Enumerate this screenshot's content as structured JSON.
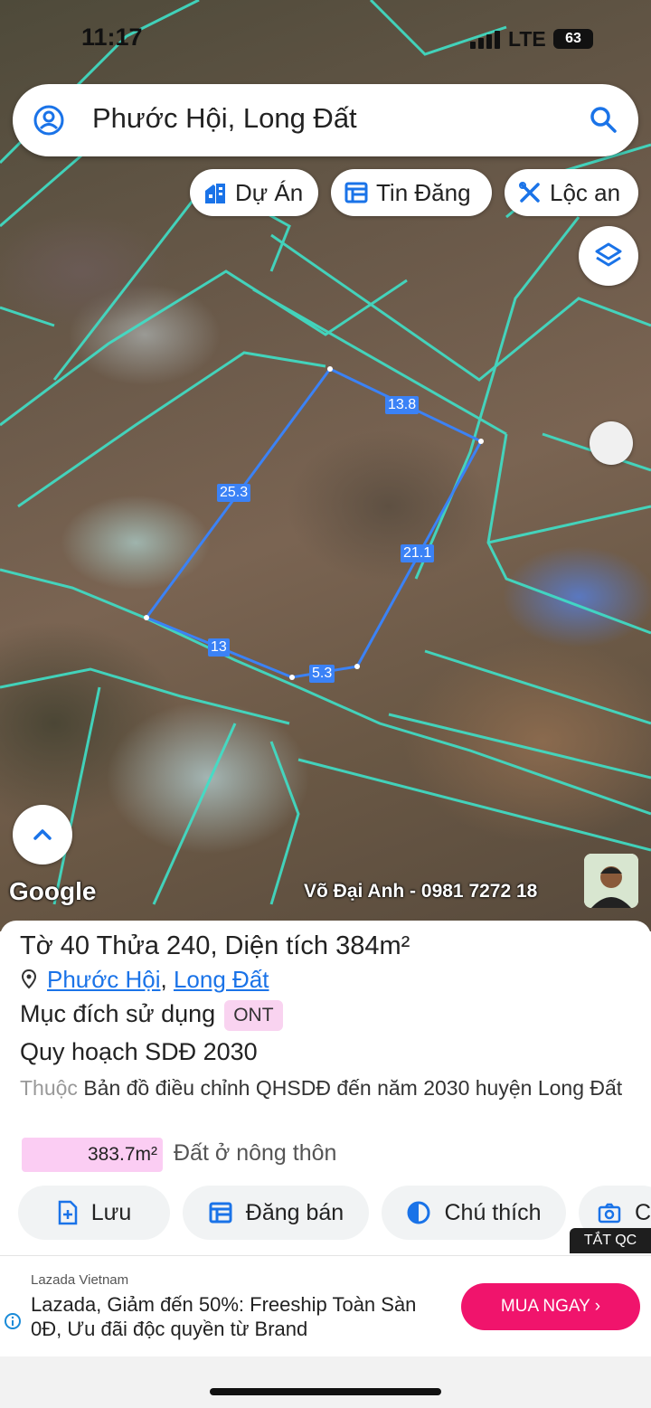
{
  "status": {
    "time": "11:17",
    "network": "LTE",
    "battery": "63"
  },
  "search": {
    "text": "Phước Hội, Long Đất"
  },
  "chips": [
    {
      "label": "Dự Án",
      "icon": "building-icon"
    },
    {
      "label": "Tin Đăng",
      "icon": "list-icon"
    },
    {
      "label": "Lộc an",
      "icon": "tools-icon"
    }
  ],
  "map": {
    "edges": [
      "13.8",
      "25.3",
      "21.1",
      "13",
      "5.3"
    ],
    "google": "Google",
    "owner": "Võ Đại Anh - 0981 7272 18"
  },
  "parcel": {
    "title_prefix": "Tờ ",
    "sheet": "40",
    "title_mid": " Thửa ",
    "lot": "240",
    "title_area_prefix": ", Diện tích ",
    "area": "384",
    "unit": "m²",
    "ward": "Phước Hội",
    "sep": ",",
    "district": "Long Đất",
    "purpose_label": "Mục đích sử dụng",
    "purpose_code": "ONT",
    "plan_label": "Quy hoạch SDĐ 2030",
    "plan_source_muted": "Thuộc",
    "plan_source": " Bản đồ điều chỉnh QHSDĐ đến năm 2030 huyện Long Đất",
    "plan_area": "383.7m²",
    "plan_type": "Đất ở nông thôn"
  },
  "actions": [
    {
      "label": "Lưu",
      "icon": "save-icon"
    },
    {
      "label": "Đăng bán",
      "icon": "post-icon"
    },
    {
      "label": "Chú thích",
      "icon": "legend-icon"
    },
    {
      "label": "C",
      "icon": "camera-icon"
    }
  ],
  "ad_close": "TẮT QC",
  "ad": {
    "advertiser": "Lazada Vietnam",
    "headline": "Lazada, Giảm đến 50%: Freeship Toàn Sàn 0Đ, Ưu đãi độc quyền từ Brand",
    "cta": "MUA NGAY"
  },
  "colors": {
    "parcel_line": "#3b82f6",
    "boundary": "#3fe0c8",
    "ad_cta": "#f0146c",
    "link": "#1a73e8"
  }
}
